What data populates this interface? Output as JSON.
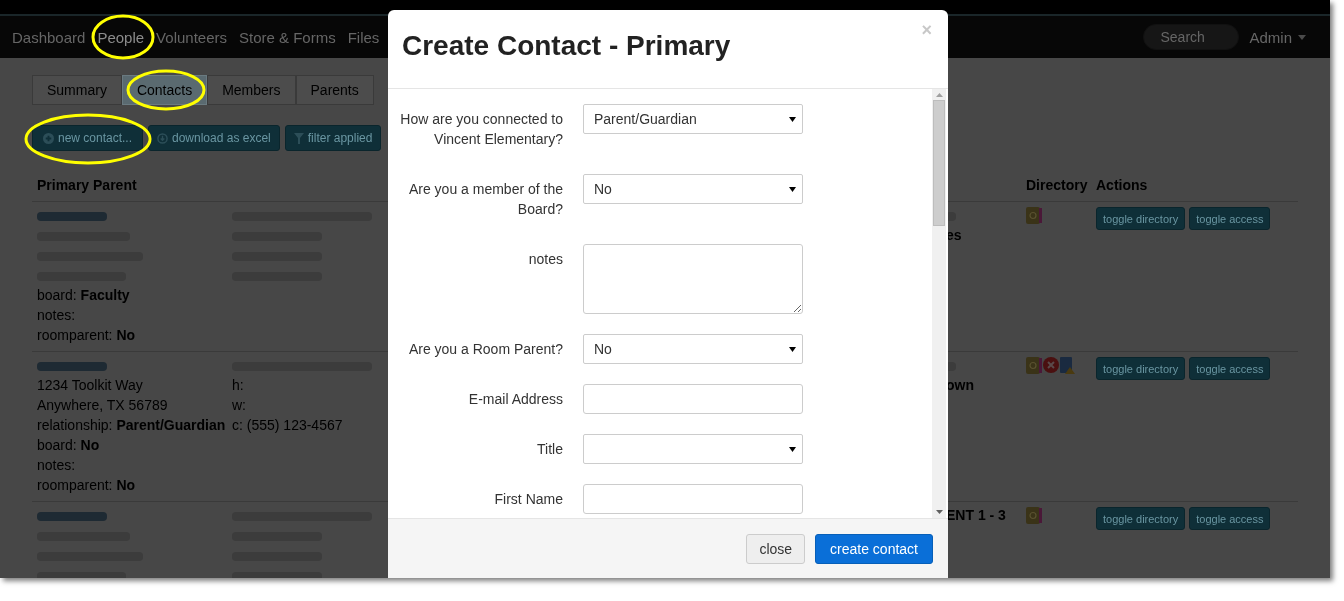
{
  "navbar": {
    "items": [
      {
        "label": "Dashboard",
        "selected": false
      },
      {
        "label": "People",
        "selected": true
      },
      {
        "label": "Volunteers",
        "selected": false
      },
      {
        "label": "Store & Forms",
        "selected": false
      },
      {
        "label": "Files",
        "selected": false
      }
    ],
    "search": {
      "placeholder": "Search"
    },
    "user_menu": "Admin"
  },
  "tabs": [
    {
      "label": "Summary",
      "selected": false
    },
    {
      "label": "Contacts",
      "selected": true
    },
    {
      "label": "Members",
      "selected": false
    },
    {
      "label": "Parents",
      "selected": false
    }
  ],
  "toolbar": [
    "new contact...",
    "download as excel",
    "filter applied"
  ],
  "table": {
    "columns": [
      {
        "label": "Primary Parent"
      },
      {
        "label": "Directory"
      },
      {
        "label": "Actions"
      }
    ],
    "rows": [
      {
        "details": [
          {
            "kind": "blurred"
          },
          {
            "kind": "blurred"
          },
          {
            "kind": "blurred"
          },
          {
            "kind": "blurred"
          },
          {
            "kind": "text",
            "text": "board: **Faculty**"
          },
          {
            "kind": "text",
            "text": "notes:"
          },
          {
            "kind": "text",
            "text": "roomparent: **No**"
          }
        ],
        "contact": [
          {
            "kind": "blurred"
          },
          {
            "kind": "blurred"
          },
          {
            "kind": "blurred"
          },
          {
            "kind": "blurred"
          }
        ],
        "fragments": [
          {
            "kind": "blurred"
          },
          {
            "kind": "text",
            "text": "es"
          }
        ],
        "directory": [
          {
            "kind": "book"
          }
        ],
        "actions": [
          "toggle directory",
          "toggle access"
        ]
      },
      {
        "details": [
          {
            "kind": "blurred"
          },
          {
            "kind": "text",
            "text": "1234 Toolkit Way"
          },
          {
            "kind": "text",
            "text": "Anywhere, TX 56789"
          },
          {
            "kind": "text",
            "text": "relationship: **Parent/Guardian**"
          },
          {
            "kind": "text",
            "text": "board: **No**"
          },
          {
            "kind": "text",
            "text": "notes:"
          },
          {
            "kind": "text",
            "text": "roomparent: **No**"
          }
        ],
        "contact": [
          {
            "kind": "blurred"
          },
          {
            "kind": "text",
            "text": "h:"
          },
          {
            "kind": "text",
            "text": "w:"
          },
          {
            "kind": "text",
            "text": "c: (555) 123-4567"
          }
        ],
        "fragments": [
          {
            "kind": "blurred"
          },
          {
            "kind": "text",
            "text": "own"
          }
        ],
        "directory": [
          {
            "kind": "book"
          },
          {
            "kind": "error"
          },
          {
            "kind": "warning"
          }
        ],
        "actions": [
          "toggle directory",
          "toggle access"
        ]
      },
      {
        "details": [
          {
            "kind": "blurred"
          },
          {
            "kind": "blurred"
          },
          {
            "kind": "blurred"
          },
          {
            "kind": "blurred"
          }
        ],
        "contact": [
          {
            "kind": "blurred"
          },
          {
            "kind": "blurred"
          },
          {
            "kind": "blurred"
          },
          {
            "kind": "blurred"
          }
        ],
        "fragments": [
          {
            "kind": "text",
            "text": "ENT 1 - 3"
          }
        ],
        "directory": [
          {
            "kind": "book"
          }
        ],
        "actions": [
          "toggle directory",
          "toggle access"
        ]
      }
    ]
  },
  "modal": {
    "title": "Create Contact - Primary",
    "close": "×",
    "fields": [
      {
        "label": "How are you connected to Vincent Elementary?",
        "kind": "select",
        "value": "Parent/Guardian"
      },
      {
        "label": "Are you a member of the Board?",
        "kind": "select",
        "value": "No"
      },
      {
        "label": "notes",
        "kind": "textarea"
      },
      {
        "label": "Are you a Room Parent?",
        "kind": "select",
        "value": "No"
      },
      {
        "label": "E-mail Address",
        "kind": "input"
      },
      {
        "label": "Title",
        "kind": "select"
      },
      {
        "label": "First Name",
        "kind": "input"
      }
    ],
    "buttons": [
      {
        "label": "close",
        "kind": "default"
      },
      {
        "label": "create contact",
        "kind": "primary"
      }
    ]
  }
}
